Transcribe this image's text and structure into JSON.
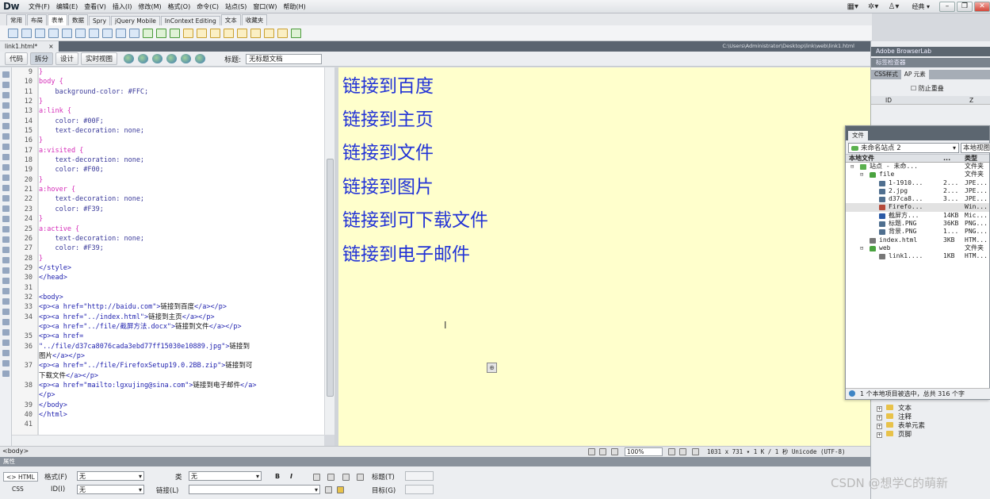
{
  "app": {
    "logo": "Dw",
    "menus": [
      "文件(F)",
      "编辑(E)",
      "查看(V)",
      "插入(I)",
      "修改(M)",
      "格式(O)",
      "命令(C)",
      "站点(S)",
      "窗口(W)",
      "帮助(H)"
    ],
    "workspace": "经典 ▾"
  },
  "insert_tabs": [
    "常用",
    "布局",
    "表单",
    "数据",
    "Spry",
    "jQuery Mobile",
    "InContext Editing",
    "文本",
    "收藏夹"
  ],
  "insert_active": 2,
  "document": {
    "tab_label": "link1.html*",
    "tab_close": "×",
    "path": "C:\\Users\\Administrator\\Desktop\\link\\web\\link1.html",
    "views": [
      "代码",
      "拆分",
      "设计",
      "实时视图"
    ],
    "active_view": 1,
    "title_label": "标题:",
    "title_value": "无标题文档"
  },
  "code": {
    "line_numbers": [
      "9",
      "10",
      "11",
      "12",
      "13",
      "14",
      "15",
      "16",
      "17",
      "18",
      "19",
      "20",
      "21",
      "22",
      "23",
      "24",
      "25",
      "26",
      "27",
      "28",
      "29",
      "30",
      "31",
      "32",
      "33",
      "34",
      "",
      "35",
      "36",
      "",
      "37",
      "",
      "38",
      "",
      "39",
      "40",
      "41"
    ],
    "lines": [
      [
        {
          "c": "sel",
          "t": "}"
        }
      ],
      [
        {
          "c": "sel",
          "t": "body {"
        }
      ],
      [
        {
          "c": "prop",
          "t": "    background-color: #FFC;"
        }
      ],
      [
        {
          "c": "sel",
          "t": "}"
        }
      ],
      [
        {
          "c": "sel",
          "t": "a:link {"
        }
      ],
      [
        {
          "c": "prop",
          "t": "    color: #00F;"
        }
      ],
      [
        {
          "c": "prop",
          "t": "    text-decoration: none;"
        }
      ],
      [
        {
          "c": "sel",
          "t": "}"
        }
      ],
      [
        {
          "c": "sel",
          "t": "a:visited {"
        }
      ],
      [
        {
          "c": "prop",
          "t": "    text-decoration: none;"
        }
      ],
      [
        {
          "c": "prop",
          "t": "    color: #F00;"
        }
      ],
      [
        {
          "c": "sel",
          "t": "}"
        }
      ],
      [
        {
          "c": "sel",
          "t": "a:hover {"
        }
      ],
      [
        {
          "c": "prop",
          "t": "    text-decoration: none;"
        }
      ],
      [
        {
          "c": "prop",
          "t": "    color: #F39;"
        }
      ],
      [
        {
          "c": "sel",
          "t": "}"
        }
      ],
      [
        {
          "c": "sel",
          "t": "a:active {"
        }
      ],
      [
        {
          "c": "prop",
          "t": "    text-decoration: none;"
        }
      ],
      [
        {
          "c": "prop",
          "t": "    color: #F39;"
        }
      ],
      [
        {
          "c": "sel",
          "t": "}"
        }
      ],
      [
        {
          "c": "tag",
          "t": "</style>"
        }
      ],
      [
        {
          "c": "tag",
          "t": "</head>"
        }
      ],
      [
        {
          "c": "txt",
          "t": ""
        }
      ],
      [
        {
          "c": "tag",
          "t": "<body>"
        }
      ],
      [
        {
          "c": "tag",
          "t": "<p><a href=\"http://baidu.com\">"
        },
        {
          "c": "txt",
          "t": "链接到百度"
        },
        {
          "c": "tag",
          "t": "</a></p>"
        }
      ],
      [
        {
          "c": "tag",
          "t": "<p><a href=\"../index.html\">"
        },
        {
          "c": "txt",
          "t": "链接到主页"
        },
        {
          "c": "tag",
          "t": "</a></p>"
        }
      ],
      [
        {
          "c": "tag",
          "t": "<p><a href=\"../file/截屏方法.docx\">"
        },
        {
          "c": "txt",
          "t": "链接到文件"
        },
        {
          "c": "tag",
          "t": "</a></p>"
        }
      ],
      [
        {
          "c": "tag",
          "t": "<p><a href="
        }
      ],
      [
        {
          "c": "tag",
          "t": "\"../file/d37ca8076cada3ebd77ff15030e10889.jpg\">"
        },
        {
          "c": "txt",
          "t": "链接到"
        }
      ],
      [
        {
          "c": "txt",
          "t": "图片"
        },
        {
          "c": "tag",
          "t": "</a></p>"
        }
      ],
      [
        {
          "c": "tag",
          "t": "<p><a href=\"../file/FirefoxSetup19.0.2BB.zip\">"
        },
        {
          "c": "txt",
          "t": "链接到可"
        }
      ],
      [
        {
          "c": "txt",
          "t": "下载文件"
        },
        {
          "c": "tag",
          "t": "</a></p>"
        }
      ],
      [
        {
          "c": "tag",
          "t": "<p><a href=\"mailto:lgxujing@sina.com\">"
        },
        {
          "c": "txt",
          "t": "链接到电子邮件"
        },
        {
          "c": "tag",
          "t": "</a>"
        }
      ],
      [
        {
          "c": "tag",
          "t": "</p>"
        }
      ],
      [
        {
          "c": "tag",
          "t": "</body>"
        }
      ],
      [
        {
          "c": "tag",
          "t": "</html>"
        }
      ],
      [
        {
          "c": "txt",
          "t": ""
        }
      ]
    ]
  },
  "design": {
    "links": [
      "链接到百度",
      "链接到主页",
      "链接到文件",
      "链接到图片",
      "链接到可下载文件",
      "链接到电子邮件"
    ],
    "link_color": "#2233d6",
    "background": "#ffffcc"
  },
  "status": {
    "tag_selector": "<body>",
    "zoom": "100%",
    "info": "1031 x 731 ▾ 1 K / 1 秒  Unicode (UTF-8)"
  },
  "properties": {
    "header": "属性",
    "html_btn": "<> HTML",
    "css_btn": "CSS",
    "format_label": "格式(F)",
    "format_value": "无",
    "class_label": "类",
    "class_value": "无",
    "id_label": "ID(I)",
    "id_value": "无",
    "link_label": "链接(L)",
    "title_label": "标题(T)",
    "target_label": "目标(G)",
    "bold": "B",
    "italic": "I"
  },
  "right_panels": {
    "browserlab": "Adobe BrowserLab",
    "tag_inspector": "标签检查器",
    "css_tab": "CSS样式",
    "ap_tab": "AP 元素",
    "prevent_overlap": "防止重叠",
    "col_id": "ID",
    "col_z": "Z"
  },
  "files_panel": {
    "tab": "文件",
    "site": "未命名站点 2",
    "view": "本地视图",
    "col_name": "本地文件",
    "col_size": "...",
    "col_type": "类型",
    "rows": [
      {
        "indent": 0,
        "exp": "⊟",
        "icon": "site",
        "name": "站点 - 未命...",
        "size": "",
        "type": "文件夹"
      },
      {
        "indent": 1,
        "exp": "⊟",
        "icon": "folder",
        "name": "file",
        "size": "",
        "type": "文件夹"
      },
      {
        "indent": 2,
        "exp": "",
        "icon": "img",
        "name": "1-1910...",
        "size": "2...",
        "type": "JPE..."
      },
      {
        "indent": 2,
        "exp": "",
        "icon": "img",
        "name": "2.jpg",
        "size": "2...",
        "type": "JPE..."
      },
      {
        "indent": 2,
        "exp": "",
        "icon": "img",
        "name": "d37ca8...",
        "size": "3...",
        "type": "JPE..."
      },
      {
        "indent": 2,
        "exp": "",
        "icon": "zip",
        "name": "Firefo...",
        "size": "",
        "type": "Win...",
        "hl": true
      },
      {
        "indent": 2,
        "exp": "",
        "icon": "doc",
        "name": "截屏方...",
        "size": "14KB",
        "type": "Mic..."
      },
      {
        "indent": 2,
        "exp": "",
        "icon": "img",
        "name": "标题.PNG",
        "size": "36KB",
        "type": "PNG..."
      },
      {
        "indent": 2,
        "exp": "",
        "icon": "img",
        "name": "背景.PNG",
        "size": "1...",
        "type": "PNG..."
      },
      {
        "indent": 1,
        "exp": "",
        "icon": "html",
        "name": "index.html",
        "size": "3KB",
        "type": "HTM..."
      },
      {
        "indent": 1,
        "exp": "⊟",
        "icon": "folder",
        "name": "web",
        "size": "",
        "type": "文件夹"
      },
      {
        "indent": 2,
        "exp": "",
        "icon": "html",
        "name": "link1....",
        "size": "1KB",
        "type": "HTM..."
      }
    ],
    "status": "1 个本地项目被选中，总共 316 个字"
  },
  "tree_below": [
    "文本",
    "注释",
    "表单元素",
    "页脚"
  ],
  "watermark": "CSDN @想学C的萌新"
}
